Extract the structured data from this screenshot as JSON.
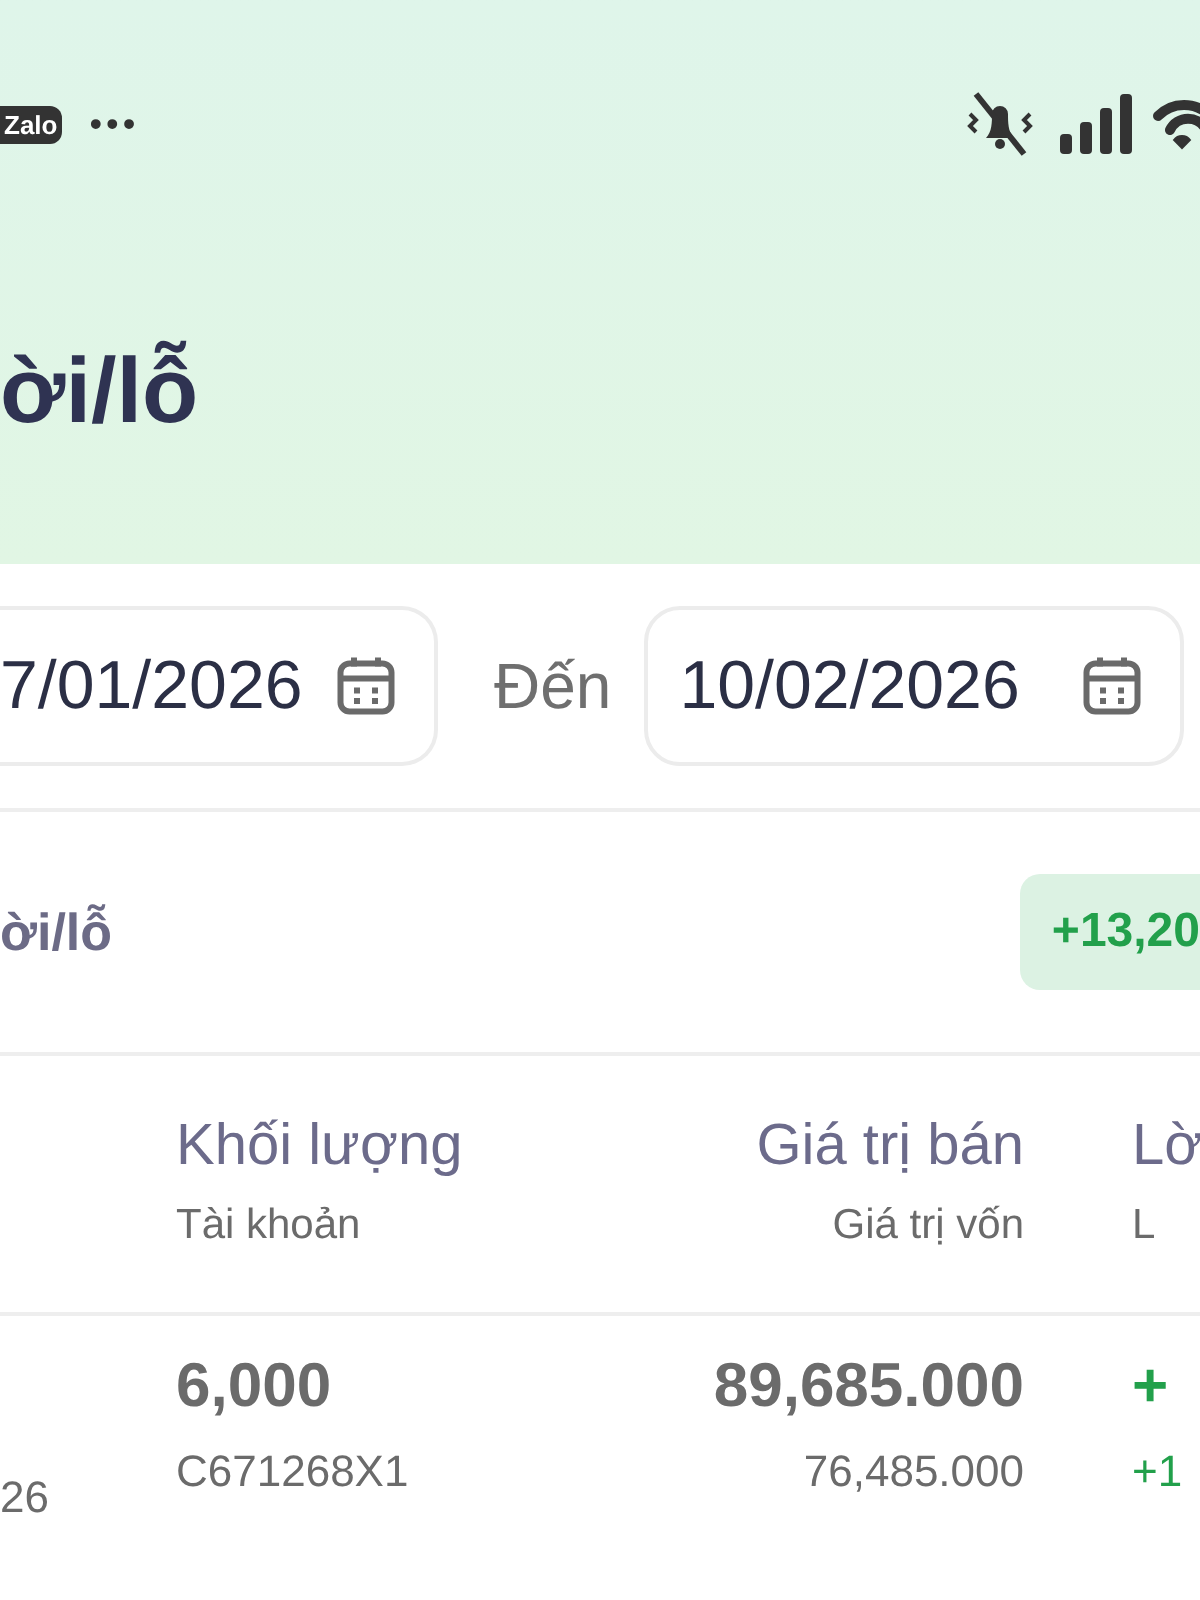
{
  "status_bar": {
    "app_label": "Zalo",
    "more": "•••"
  },
  "header": {
    "title": "ời/lỗ"
  },
  "date_range": {
    "from": "7/01/2026",
    "to_label": "Đến",
    "to": "10/02/2026"
  },
  "summary": {
    "label": "ời/lỗ",
    "total": "+13,20"
  },
  "table": {
    "columns": [
      {
        "title": "Khối lượng",
        "subtitle": "Tài khoản"
      },
      {
        "title": "Giá trị bán",
        "subtitle": "Giá trị vốn"
      },
      {
        "title": "Lờ",
        "subtitle": "L"
      }
    ],
    "rows": [
      {
        "column_1": "26",
        "cells": [
          {
            "main": "6,000",
            "sub": "C671268X1",
            "kind": "plain"
          },
          {
            "main": "89,685.000",
            "sub": "76,485.000",
            "kind": "plain"
          },
          {
            "main": "+",
            "sub": "+1",
            "kind": "gain"
          }
        ]
      }
    ]
  }
}
